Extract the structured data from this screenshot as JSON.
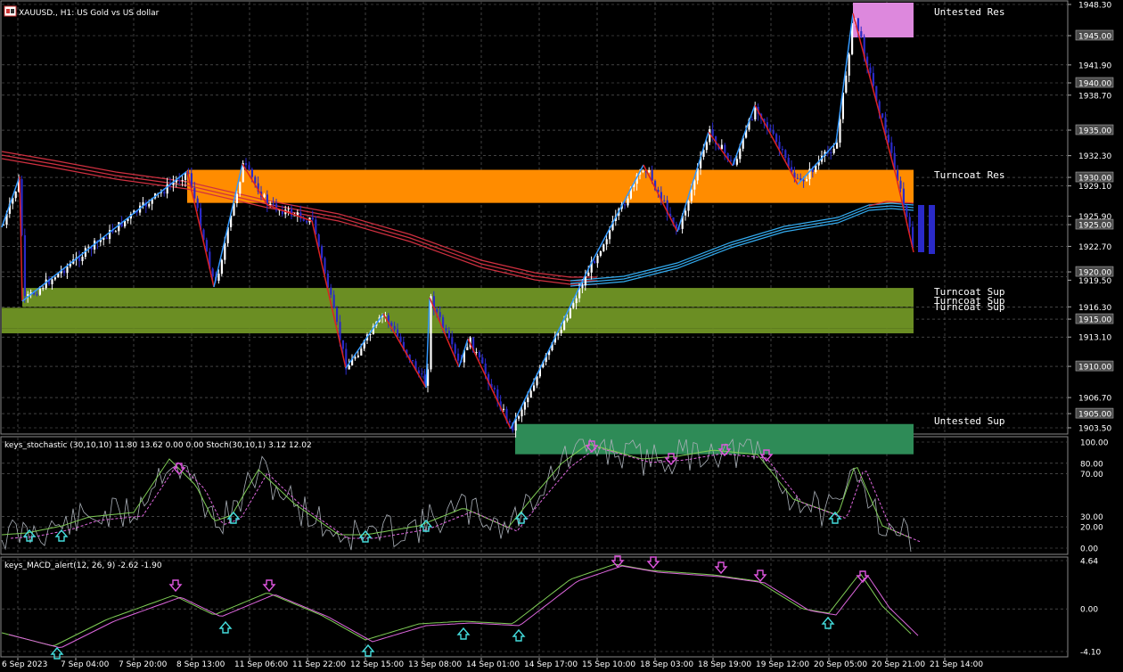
{
  "window": {
    "symbol_title": "XAUUSD., H1:  US Gold vs US dollar",
    "icon": "chart-window-icon"
  },
  "main": {
    "price_labels": [
      "1948.30",
      "1945.00",
      "1941.90",
      "1940.00",
      "1938.70",
      "1935.00",
      "1932.30",
      "1930.00",
      "1929.10",
      "1925.90",
      "1925.00",
      "1922.70",
      "1920.00",
      "1919.50",
      "1916.30",
      "1915.00",
      "1913.10",
      "1910.00",
      "1906.70",
      "1905.00",
      "1903.50"
    ],
    "zones": [
      {
        "label": "Untested Res",
        "color": "#dd88dd"
      },
      {
        "label": "Turncoat Res",
        "color": "#ff8c00"
      },
      {
        "label": "Turncoat Sup",
        "color": "#6b8e23"
      },
      {
        "label": "Turncoat Sup",
        "color": "#6b8e23"
      },
      {
        "label": "Turncoat Sup",
        "color": "#6b8e23"
      },
      {
        "label": "Untested Sup",
        "color": "#2e8b57"
      }
    ]
  },
  "stoch": {
    "title": "keys_stochastic (30,10,10) 11.80 13.62 0.00 0.00 Stoch(30,10,1) 3.12 12.02",
    "levels": [
      "100.00",
      "80.00",
      "70.00",
      "30.00",
      "20.00",
      "0.00"
    ]
  },
  "macd": {
    "title": "keys_MACD_alert(12, 26, 9) -2.62 -1.90",
    "levels": [
      "4.64",
      "0.00",
      "-4.10"
    ]
  },
  "time_axis": [
    "6 Sep 2023",
    "7 Sep 04:00",
    "7 Sep 20:00",
    "8 Sep 13:00",
    "11 Sep 06:00",
    "11 Sep 22:00",
    "12 Sep 15:00",
    "13 Sep 08:00",
    "14 Sep 01:00",
    "14 Sep 17:00",
    "15 Sep 10:00",
    "18 Sep 03:00",
    "18 Sep 19:00",
    "19 Sep 12:00",
    "20 Sep 05:00",
    "20 Sep 21:00",
    "21 Sep 14:00"
  ],
  "colors": {
    "bull": "#ffffff",
    "bear": "#2a2ac8",
    "zigzag_up": "#3399ff",
    "zigzag_down": "#dd2222",
    "ma_red": "#d03040",
    "ma_blue": "#33aaee",
    "grid": "#6a6a6a"
  }
}
